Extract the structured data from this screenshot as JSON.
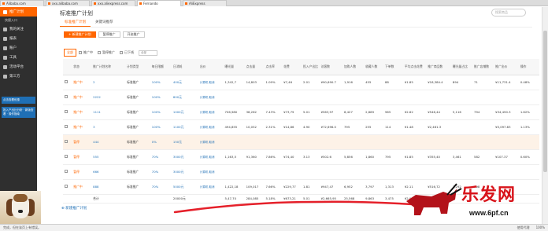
{
  "browser_tabs": [
    {
      "title": "Alibaba.com",
      "active": false
    },
    {
      "title": "xxx.alibaba.com",
      "active": false
    },
    {
      "title": "xxx.aliexpress.com",
      "active": false
    },
    {
      "title": "Fernando",
      "active": true
    },
    {
      "title": "AliExpress",
      "active": false
    }
  ],
  "sidebar": {
    "items": [
      {
        "label": "推广计划",
        "active": true,
        "icon": "megaphone-icon"
      },
      {
        "label": "我的关注",
        "active": false,
        "icon": "star-icon"
      },
      {
        "label": "报表",
        "active": false,
        "icon": "chart-icon"
      },
      {
        "label": "账户",
        "active": false,
        "icon": "user-icon"
      },
      {
        "label": "工具",
        "active": false,
        "icon": "wrench-icon"
      },
      {
        "label": "活动平台",
        "active": false,
        "icon": "flag-icon"
      },
      {
        "label": "第三方",
        "active": false,
        "icon": "link-icon"
      }
    ],
    "sub_label": "快捷入口",
    "blue_block_1": "点击查看优惠",
    "blue_block_2": "投入产出比分析 · 新版查看 · 操作指南"
  },
  "page": {
    "title": "标准推广计划",
    "search_placeholder": "搜索商品",
    "subtabs": [
      "标准推广计划",
      "关键词推荐"
    ],
    "toolbar": {
      "new_plan": "+ 新建推广计划",
      "btn2": "暂停推广",
      "btn3": "开启推广"
    },
    "filter": {
      "tag": "全部",
      "options": [
        "推广中",
        "暂停推广",
        "已下线"
      ],
      "select_placeholder": "全部"
    },
    "add_link": "新建推广计划"
  },
  "table": {
    "headers": [
      "",
      "状态",
      "推广计划名称",
      "计划类型",
      "每日限额",
      "日消耗",
      "出价",
      "曝光量",
      "点击量",
      "点击率",
      "花费",
      "投入产出比",
      "访客数",
      "加购人数",
      "收藏人数",
      "下单数",
      "平均点击花费",
      "推广商品数",
      "曝光量占比",
      "推广店铺数",
      "推广出价",
      "操作"
    ],
    "rows": [
      {
        "status": "推广中",
        "name": "2",
        "type": "标准推广",
        "limit": "100%",
        "daily": "400元",
        "bid": "计算机 取消",
        "exposure": "1,342,7",
        "clicks": "14,803",
        "ctr": "1.09%",
        "cost": "¥7,46",
        "roi": "2.01",
        "visitors": "¥90,690.7",
        "cart": "1,916",
        "fav": "455",
        "orders": "88",
        "avg": "¥1.85",
        "items": "¥18,384.4",
        "share": "894",
        "shops": "71",
        "pbid": "¥11,731.4",
        "op": "0.48%",
        "hl": false
      },
      {
        "status": "推广中",
        "name": "2222",
        "type": "标准推广",
        "limit": "100%",
        "daily": "800元",
        "bid": "计算机 取消",
        "exposure": "",
        "clicks": "",
        "ctr": "",
        "cost": "",
        "roi": "",
        "visitors": "",
        "cart": "",
        "fav": "",
        "orders": "",
        "avg": "",
        "items": "",
        "share": "",
        "shops": "",
        "pbid": "",
        "op": "",
        "hl": false
      },
      {
        "status": "推广中",
        "name": "1111",
        "type": "标准推广",
        "limit": "100%",
        "daily": "1000元",
        "bid": "计算机 取消",
        "exposure": "706,980",
        "clicks": "38,262",
        "ctr": "7.43%",
        "cost": "¥73,79",
        "roi": "5.01",
        "visitors": "¥563,97",
        "cart": "8,427",
        "fav": "2,889",
        "orders": "965",
        "avg": "¥2.62",
        "items": "¥546,44",
        "share": "5,116",
        "shops": "794",
        "pbid": "¥34,490.3",
        "op": "1.62%",
        "hl": false
      },
      {
        "status": "推广中",
        "name": "3",
        "type": "标准推广",
        "limit": "100%",
        "daily": "1100元",
        "bid": "计算机 取消",
        "exposure": "494,855",
        "clicks": "10,052",
        "ctr": "2.31%",
        "cost": "¥14,86",
        "roi": "4.90",
        "visitors": "¥72,696.0",
        "cart": "795",
        "fav": "255",
        "orders": "114",
        "avg": "¥1.48",
        "items": "¥2,461.3",
        "share": "",
        "shops": "",
        "pbid": "¥5,097.83",
        "op": "1.13%",
        "hl": false
      },
      {
        "status": "暂停",
        "name": "444",
        "type": "标准推广",
        "limit": "0%",
        "daily": "150元",
        "bid": "计算机 取消",
        "exposure": "",
        "clicks": "",
        "ctr": "",
        "cost": "",
        "roi": "",
        "visitors": "",
        "cart": "",
        "fav": "",
        "orders": "",
        "avg": "",
        "items": "",
        "share": "",
        "shops": "",
        "pbid": "",
        "op": "",
        "hl": true
      },
      {
        "status": "暂停",
        "name": "555",
        "type": "标准推广",
        "limit": "70%",
        "daily": "3000元",
        "bid": "计算机 取消",
        "exposure": "1,163,5",
        "clicks": "91,360",
        "ctr": "7.86%",
        "cost": "¥74,40",
        "roi": "3.13",
        "visitors": "¥502.6",
        "cart": "5,856",
        "fav": "1,860",
        "orders": "795",
        "avg": "¥1.85",
        "items": "¥355,40",
        "share": "3,461",
        "shops": "582",
        "pbid": "¥107.37",
        "op": "0.60%",
        "hl": false
      },
      {
        "status": "暂停",
        "name": "666",
        "type": "标准推广",
        "limit": "70%",
        "daily": "3000元",
        "bid": "计算机 取消",
        "exposure": "",
        "clicks": "",
        "ctr": "",
        "cost": "",
        "roi": "",
        "visitors": "",
        "cart": "",
        "fav": "",
        "orders": "",
        "avg": "",
        "items": "",
        "share": "",
        "shops": "",
        "pbid": "",
        "op": "",
        "hl": false
      },
      {
        "status": "推广中",
        "name": "888",
        "type": "标准推广",
        "limit": "70%",
        "daily": "5000元",
        "bid": "计算机 取消",
        "exposure": "1,422,18",
        "clicks": "109,017",
        "ctr": "7.66%",
        "cost": "¥229,77",
        "roi": "1.81",
        "visitors": "¥947,47",
        "cart": "6,952",
        "fav": "3,797",
        "orders": "1,313",
        "avg": "¥2.11",
        "items": "¥516,72",
        "share": "7,292",
        "shops": "698",
        "pbid": "",
        "op": "",
        "hl": false
      }
    ],
    "total": {
      "label": "合计",
      "daily": "20000元",
      "exposure": "5,47,70",
      "clicks": "284,085",
      "ctr": "5.18%",
      "cost": "¥673,21",
      "roi": "5.01",
      "visitors": "¥2,665,95",
      "cart": "25,568",
      "fav": "9,863",
      "orders": "3,475",
      "avg": "¥2.02"
    }
  },
  "statusbar": {
    "left": "完成，但在该页上有错误。",
    "right": [
      "使用代理",
      "100%"
    ]
  },
  "watermark": {
    "text": "乐发网",
    "url": "www.6pf.cn"
  },
  "colors": {
    "accent": "#ff6600",
    "link": "#1f6fb5",
    "sidebar": "#2f2f2f",
    "watermark": "#d8141b"
  }
}
